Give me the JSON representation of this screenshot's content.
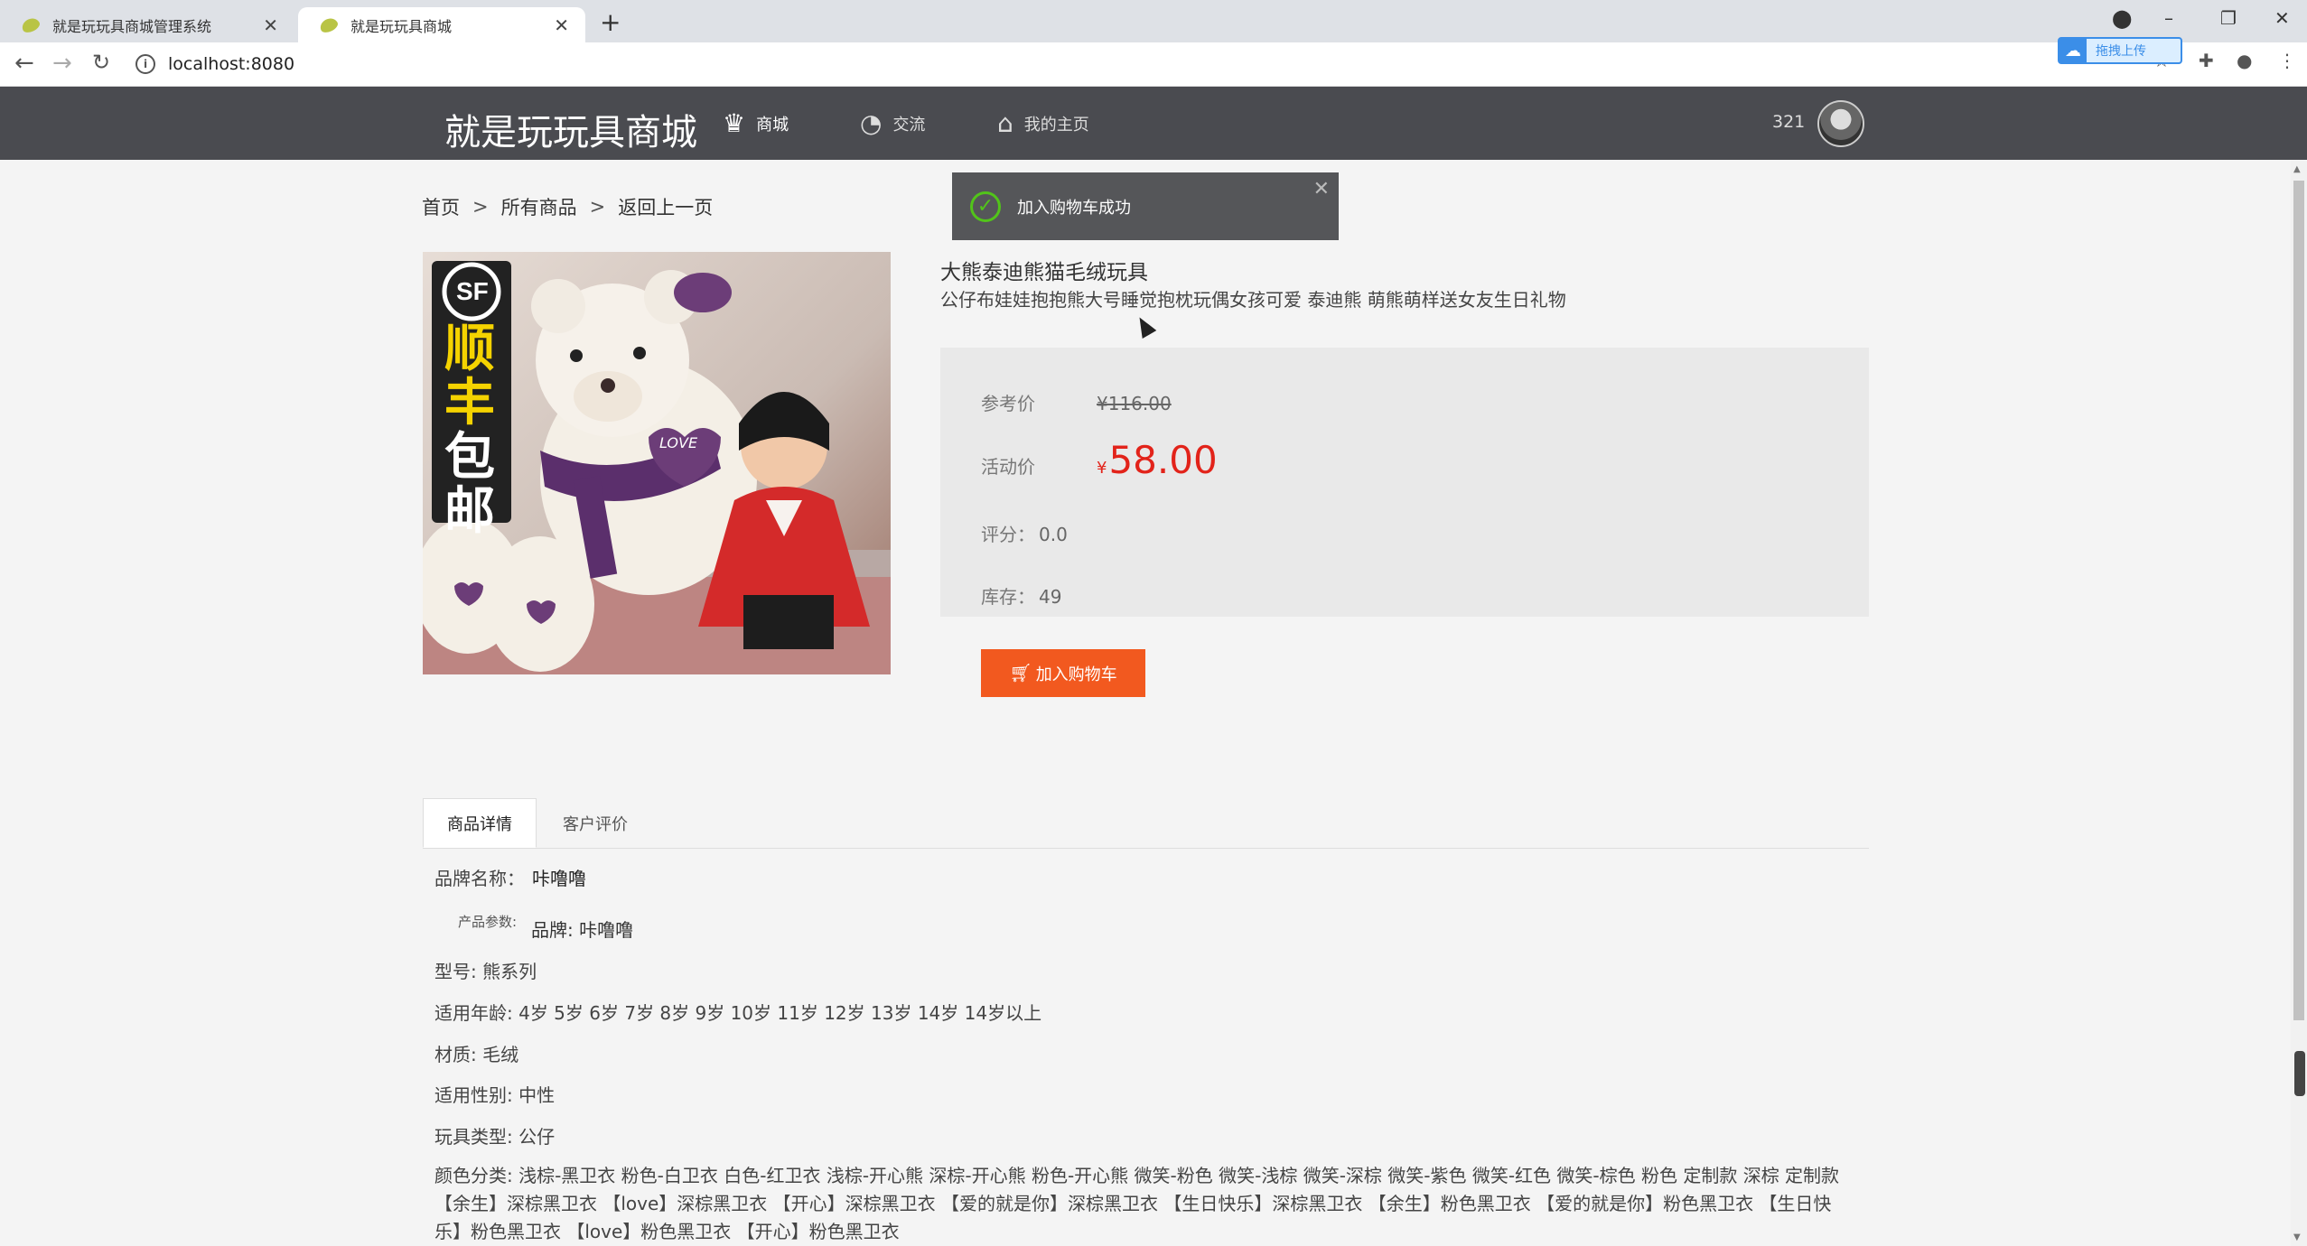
{
  "browser": {
    "tabs": [
      {
        "title": "就是玩玩具商城管理系统",
        "close": "✕"
      },
      {
        "title": "就是玩玩具商城",
        "close": "✕"
      }
    ],
    "new_tab": "+",
    "url": "localhost:8080",
    "upload_label": "拖拽上传"
  },
  "header": {
    "logo": "就是玩玩具商城",
    "nav": [
      {
        "label": "商城",
        "icon": "crown-icon"
      },
      {
        "label": "交流",
        "icon": "chat-icon"
      },
      {
        "label": "我的主页",
        "icon": "home-icon"
      }
    ],
    "username": "321"
  },
  "breadcrumb": {
    "items": [
      "首页",
      "所有商品",
      "返回上一页"
    ],
    "separator": ">"
  },
  "toast": {
    "message": "加入购物车成功"
  },
  "product": {
    "image_text": {
      "sf": "SF",
      "lines": [
        "顺",
        "丰",
        "包",
        "邮"
      ],
      "heart": "LOVE"
    },
    "name": "大熊泰迪熊猫毛绒玩具",
    "description": "公仔布娃娃抱抱熊大号睡觉抱枕玩偶女孩可爱 泰迪熊 萌熊萌样送女友生日礼物",
    "ref_price_label": "参考价",
    "ref_price": "¥116.00",
    "sale_price_label": "活动价",
    "currency": "¥",
    "sale_price": "58.00",
    "rating_label": "评分：",
    "rating": "0.0",
    "stock_label": "库存：",
    "stock": "49",
    "add_to_cart": "加入购物车"
  },
  "detail_tabs": [
    "商品详情",
    "客户评价"
  ],
  "details": {
    "brand_label": "品牌名称：",
    "brand_value": "咔噜噜",
    "param_label": "产品参数:",
    "param_brand": "品牌: 咔噜噜",
    "model": "型号: 熊系列",
    "age": "适用年龄: 4岁 5岁 6岁 7岁 8岁 9岁 10岁 11岁 12岁 13岁 14岁 14岁以上",
    "material": "材质: 毛绒",
    "gender": "适用性别: 中性",
    "toy_type": "玩具类型: 公仔",
    "colors": "颜色分类: 浅棕-黑卫衣 粉色-白卫衣 白色-红卫衣 浅棕-开心熊 深棕-开心熊 粉色-开心熊 微笑-粉色 微笑-浅棕 微笑-深棕 微笑-紫色 微笑-红色 微笑-棕色 粉色 定制款 深棕 定制款 【余生】深棕黑卫衣 【love】深棕黑卫衣 【开心】深棕黑卫衣 【爱的就是你】深棕黑卫衣 【生日快乐】深棕黑卫衣 【余生】粉色黑卫衣 【爱的就是你】粉色黑卫衣 【生日快乐】粉色黑卫衣 【love】粉色黑卫衣 【开心】粉色黑卫衣"
  },
  "colors": {
    "header_bg": "#4a4b50",
    "price_red": "#e2231a",
    "cart_orange": "#f2591f",
    "toast_bg": "#555659"
  }
}
